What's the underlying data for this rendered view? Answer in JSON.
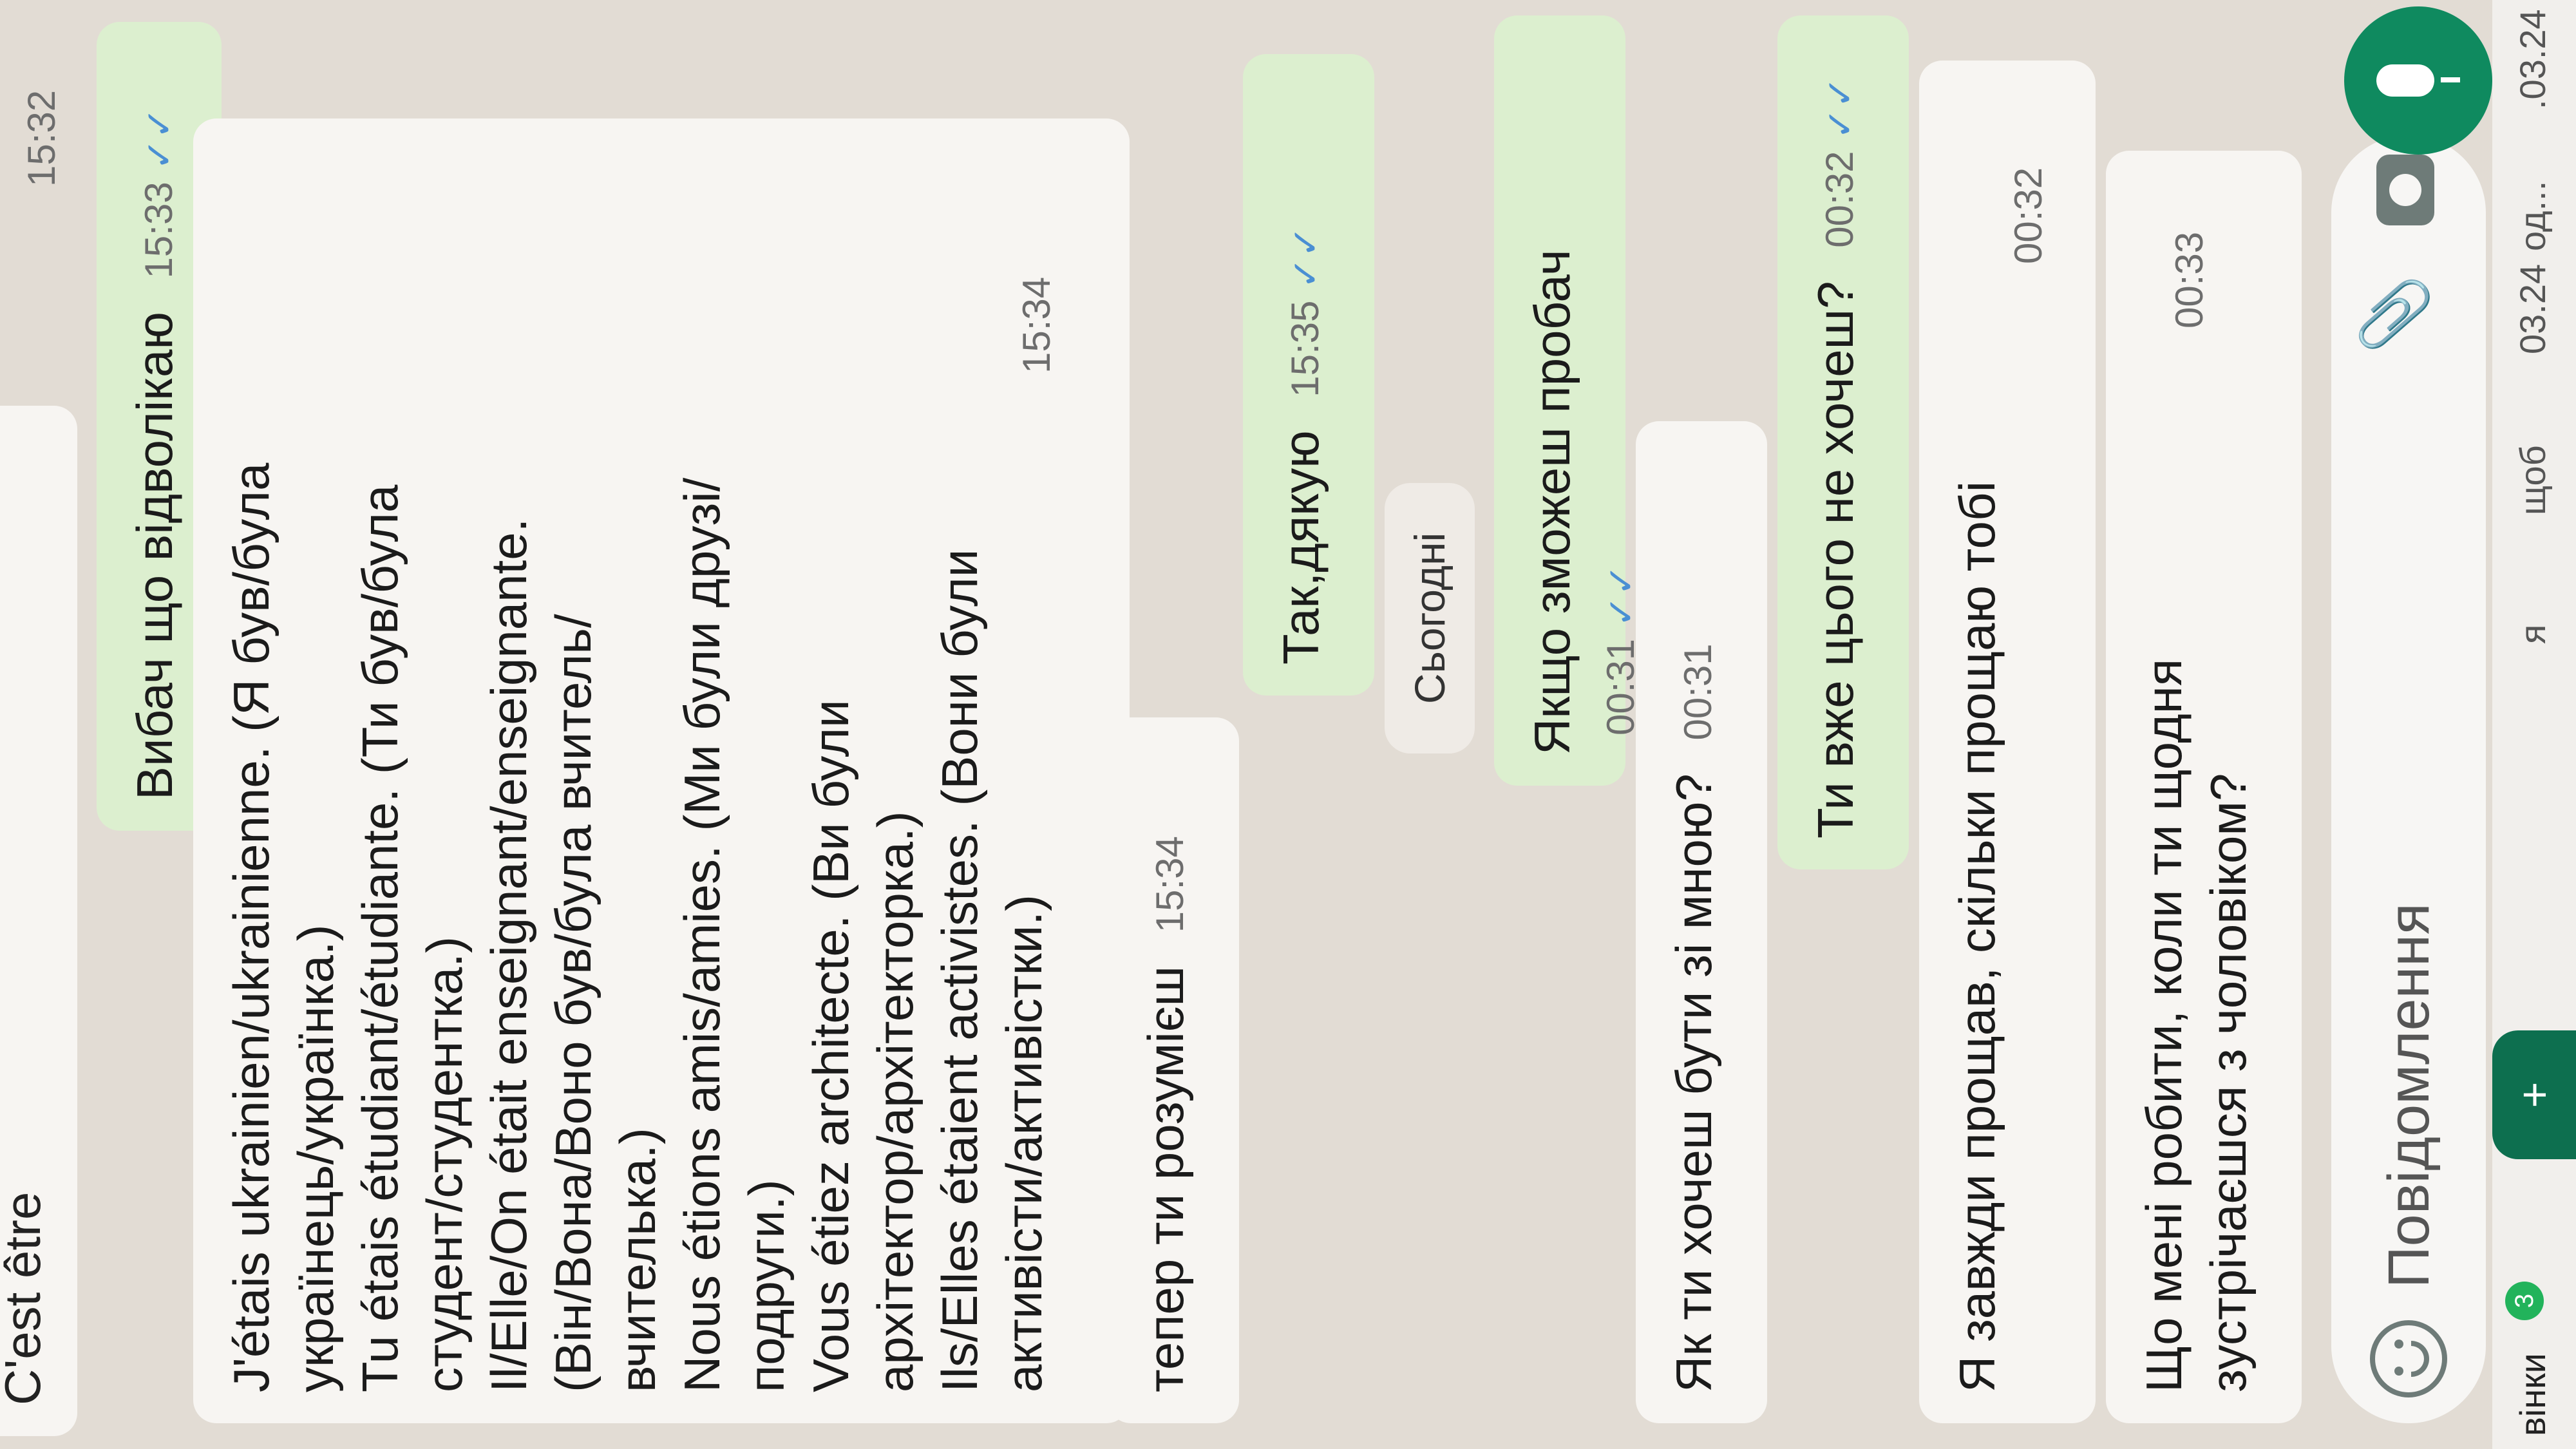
{
  "chat_list": {
    "items": [
      {
        "date": ".03.24",
        "sub": "од..."
      },
      {
        "date": "03.24",
        "sub": "щоб"
      },
      {
        "date": "",
        "sub": "я"
      }
    ],
    "calls_label": "вінки",
    "calls_badge": "3",
    "fab_label": "+"
  },
  "top_cut": {
    "text": "C'est être",
    "time": "15:32"
  },
  "messages": [
    {
      "dir": "out",
      "text": "Вибач що відволікаю",
      "time": "15:33",
      "ticks": "✓✓"
    },
    {
      "dir": "in",
      "lines": [
        "J'étais ukrainien/ukrainienne. (Я був/була",
        "українець/українка.)",
        "Tu étais étudiant/étudiante. (Ти був/була",
        "студент/студентка.)",
        "Il/Elle/On était enseignant/enseignante.",
        "(Він/Вона/Воно був/була вчитель/",
        "вчителька.)",
        "Nous étions amis/amies. (Ми були друзі/",
        "подруги.)",
        "Vous étiez architecte. (Ви були",
        "архітектор/архітекторка.)",
        "Ils/Elles étaient activistes. (Вони були",
        "активісти/активістки.)"
      ],
      "time": "15:34"
    },
    {
      "dir": "in",
      "text": "тепер ти розумієш",
      "time": "15:34"
    },
    {
      "dir": "out",
      "text": "Так,дякую",
      "time": "15:35",
      "ticks": "✓✓"
    },
    {
      "dir": "out",
      "text": "Якщо зможеш пробач",
      "time": "00:31",
      "ticks": "✓✓"
    },
    {
      "dir": "in",
      "text": "Як ти хочеш бути зі мною?",
      "time": "00:31"
    },
    {
      "dir": "out",
      "text": "Ти вже цього не хочеш?",
      "time": "00:32",
      "ticks": "✓✓"
    },
    {
      "dir": "in",
      "text": "Я завжди прощав, скільки прощаю тобі",
      "time": "00:32"
    },
    {
      "dir": "in",
      "lines": [
        "Що мені робити, коли ти щодня",
        "зустрічаєшся з чоловіком?"
      ],
      "time": "00:33"
    }
  ],
  "day_separator": "Сьогодні",
  "composer": {
    "placeholder": "Повідомлення"
  },
  "colors": {
    "outgoing": "#dcefcf",
    "incoming": "#f7f5f2",
    "accent": "#0f8a5f",
    "ticks": "#4a8fd3"
  }
}
